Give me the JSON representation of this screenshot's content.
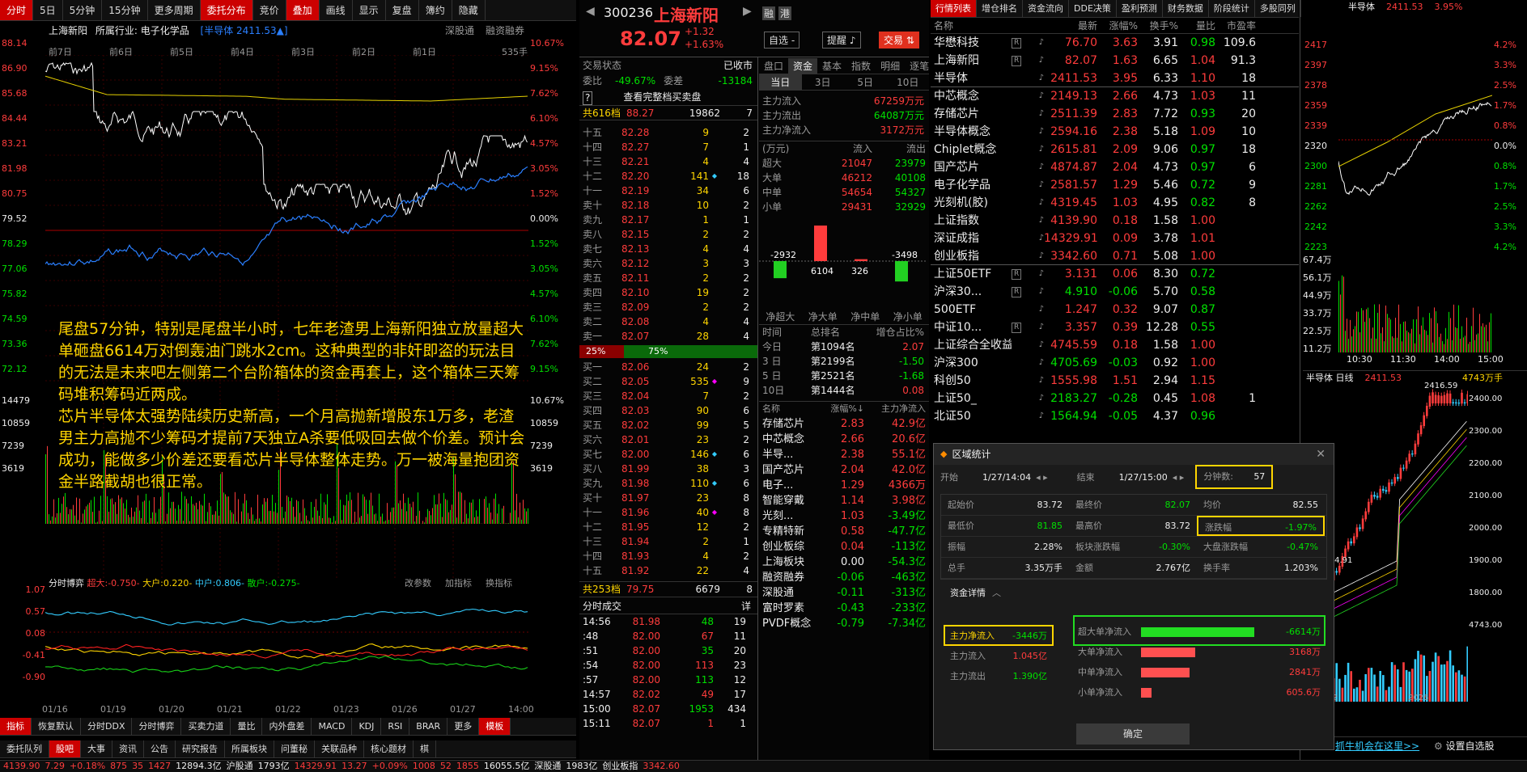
{
  "left": {
    "tabs": [
      "分时",
      "5日",
      "5分钟",
      "15分钟",
      "更多周期",
      "委托分布",
      "竞价",
      "叠加",
      "画线",
      "显示",
      "复盘",
      "簿约",
      "隐藏"
    ],
    "stock_name": "上海新阳",
    "industry": "所属行业: 电子化学品",
    "overlay": "[半导体 2411.53▲]",
    "top_right": [
      "深股通",
      "融资融券"
    ],
    "days": [
      "前7日",
      "前6日",
      "前5日",
      "前4日",
      "前3日",
      "前2日",
      "前1日"
    ],
    "vol_label": "535手",
    "price_axis": [
      "88.14",
      "86.90",
      "85.68",
      "84.44",
      "83.21",
      "81.98",
      "80.75",
      "79.52",
      "78.29",
      "77.06",
      "75.82",
      "74.59",
      "73.36",
      "72.12",
      "14479",
      "10859",
      "7239",
      "3619"
    ],
    "pct_axis": [
      "10.67%",
      "9.15%",
      "7.62%",
      "6.10%",
      "4.57%",
      "3.05%",
      "1.52%",
      "0.00%",
      "1.52%",
      "3.05%",
      "4.57%",
      "6.10%",
      "7.62%",
      "9.15%",
      "10.67%",
      "10859",
      "7239",
      "3619"
    ],
    "annotation": "尾盘57分钟，特别是尾盘半小时，七年老渣男上海新阳独立放量超大单砸盘6614万对倒轰油门跳水2cm。这种典型的非奸即盗的玩法目的无法是未来吧左侧第二个台阶箱体的资金再套上，这个箱体三天筹码堆积筹码近两成。\n芯片半导体太强势陆续历史新高，一个月高抛新增股东1万多，老渣男主力高抛不少筹码才提前7天独立A杀要低吸回去做个价差。预计会成功，能做多少价差还要看芯片半导体整体走势。万一被海量抱团资金半路截胡也很正常。",
    "indicator_title": "分时博弈",
    "indicator_vals": [
      "超大:-0.750-",
      "大户:0.220-",
      "中户:0.806-",
      "散户:-0.275-"
    ],
    "indicator_btns": [
      "改参数",
      "加指标",
      "换指标"
    ],
    "ind_axis": [
      "1.07",
      "0.57",
      "0.08",
      "-0.41",
      "-0.90"
    ],
    "dates": [
      "01/16",
      "01/19",
      "01/20",
      "01/21",
      "01/22",
      "01/23",
      "01/26",
      "01/27",
      "14:00"
    ],
    "bottom_tabs": [
      "指标",
      "恢复默认",
      "分时DDX",
      "分时博弈",
      "买卖力道",
      "量比",
      "内外盘差",
      "MACD",
      "KDJ",
      "RSI",
      "BRAR",
      "更多",
      "模板"
    ],
    "footer_tabs": [
      "委托队列",
      "股吧",
      "大事",
      "资讯",
      "公告",
      "研究报告",
      "所属板块",
      "问董秘",
      "关联品种",
      "核心题材",
      "棋"
    ]
  },
  "mid": {
    "code": "300236",
    "name": "上海新阳",
    "price": "82.07",
    "chg": "+1.32",
    "pct": "+1.63%",
    "badges": [
      "融",
      "港"
    ],
    "btn_self": "自选 -",
    "btn_alert": "提醒",
    "btn_trade": "交易",
    "status_label": "交易状态",
    "status": "已收市",
    "wb_label": "委比",
    "wb": "-49.67%",
    "wc_label": "委差",
    "wc": "-13184",
    "view_all": "查看完整档买卖盘",
    "total_sell_label": "共616档",
    "total_sell_px": "88.27",
    "total_sell_vol": "19862",
    "total_sell_n": "7",
    "asks": [
      [
        "十五",
        "82.28",
        "9",
        "2"
      ],
      [
        "十四",
        "82.27",
        "7",
        "1"
      ],
      [
        "十三",
        "82.21",
        "4",
        "4"
      ],
      [
        "十二",
        "82.20",
        "141",
        "18"
      ],
      [
        "十一",
        "82.19",
        "34",
        "6"
      ],
      [
        "卖十",
        "82.18",
        "10",
        "2"
      ],
      [
        "卖九",
        "82.17",
        "1",
        "1"
      ],
      [
        "卖八",
        "82.15",
        "2",
        "2"
      ],
      [
        "卖七",
        "82.13",
        "4",
        "4"
      ],
      [
        "卖六",
        "82.12",
        "3",
        "3"
      ],
      [
        "卖五",
        "82.11",
        "2",
        "2"
      ],
      [
        "卖四",
        "82.10",
        "19",
        "2"
      ],
      [
        "卖三",
        "82.09",
        "2",
        "2"
      ],
      [
        "卖二",
        "82.08",
        "4",
        "4"
      ],
      [
        "卖一",
        "82.07",
        "28",
        "4"
      ]
    ],
    "ratio_l": "25%",
    "ratio_r": "75%",
    "bids": [
      [
        "买一",
        "82.06",
        "24",
        "2"
      ],
      [
        "买二",
        "82.05",
        "535",
        "9"
      ],
      [
        "买三",
        "82.04",
        "7",
        "2"
      ],
      [
        "买四",
        "82.03",
        "90",
        "6"
      ],
      [
        "买五",
        "82.02",
        "99",
        "5"
      ],
      [
        "买六",
        "82.01",
        "23",
        "2"
      ],
      [
        "买七",
        "82.00",
        "146",
        "6"
      ],
      [
        "买八",
        "81.99",
        "38",
        "3"
      ],
      [
        "买九",
        "81.98",
        "110",
        "6"
      ],
      [
        "买十",
        "81.97",
        "23",
        "8"
      ],
      [
        "十一",
        "81.96",
        "40",
        "8"
      ],
      [
        "十二",
        "81.95",
        "12",
        "2"
      ],
      [
        "十三",
        "81.94",
        "2",
        "1"
      ],
      [
        "十四",
        "81.93",
        "4",
        "2"
      ],
      [
        "十五",
        "81.92",
        "22",
        "4"
      ]
    ],
    "total_buy_label": "共253档",
    "total_buy_px": "79.75",
    "total_buy_vol": "6679",
    "total_buy_n": "8",
    "trades_title": "分时成交",
    "trades_btn": "详",
    "trades": [
      [
        "14:56",
        "81.98",
        "48",
        "19"
      ],
      [
        ":48",
        "82.00",
        "67",
        "11"
      ],
      [
        ":51",
        "82.00",
        "35",
        "20"
      ],
      [
        ":54",
        "82.00",
        "113",
        "23"
      ],
      [
        ":57",
        "82.00",
        "113",
        "12"
      ],
      [
        "14:57",
        "82.02",
        "49",
        "17"
      ],
      [
        "15:00",
        "82.07",
        "1953",
        "434"
      ],
      [
        "15:11",
        "82.07",
        "1",
        "1"
      ]
    ],
    "fund_tabs": [
      "盘口",
      "资金",
      "基本",
      "指数",
      "明细",
      "逐笔"
    ],
    "period_tabs": [
      "当日",
      "3日",
      "5日",
      "10日"
    ],
    "flow": [
      [
        "主力流入",
        "67259万元"
      ],
      [
        "主力流出",
        "64087万元"
      ],
      [
        "主力净流入",
        "3172万元"
      ]
    ],
    "flow_hdr": [
      "(万元)",
      "流入",
      "流出"
    ],
    "flow_tbl": [
      [
        "超大",
        "21047",
        "23979"
      ],
      [
        "大单",
        "46212",
        "40108"
      ],
      [
        "中单",
        "54654",
        "54327"
      ],
      [
        "小单",
        "29431",
        "32929"
      ]
    ],
    "bar_vals": [
      "-2932",
      "6104",
      "326",
      "-3498"
    ],
    "bar_data": [
      -2932,
      6104,
      326,
      -3498
    ],
    "bar_labels": [
      "净超大",
      "净大单",
      "净中单",
      "净小单"
    ],
    "rank_hdr": [
      "时间",
      "总排名",
      "增仓占比%"
    ],
    "rank": [
      [
        "今日",
        "第1094名",
        "2.07"
      ],
      [
        "3 日",
        "第2199名",
        "-1.50"
      ],
      [
        "5 日",
        "第2521名",
        "-1.68"
      ],
      [
        "10日",
        "第1444名",
        "0.08"
      ]
    ],
    "sec_hdr": [
      "名称",
      "涨幅%↓",
      "主力净流入"
    ],
    "sectors": [
      [
        "存储芯片",
        "2.83",
        "42.9亿"
      ],
      [
        "中芯概念",
        "2.66",
        "20.6亿"
      ],
      [
        "半导...",
        "2.38",
        "55.1亿"
      ],
      [
        "国产芯片",
        "2.04",
        "42.0亿"
      ],
      [
        "电子...",
        "1.29",
        "4366万"
      ],
      [
        "智能穿戴",
        "1.14",
        "3.98亿"
      ],
      [
        "光刻...",
        "1.03",
        "-3.49亿"
      ],
      [
        "专精特新",
        "0.58",
        "-47.7亿"
      ],
      [
        "创业板综",
        "0.04",
        "-113亿"
      ],
      [
        "上海板块",
        "0.00",
        "-54.3亿"
      ],
      [
        "融资融券",
        "-0.06",
        "-463亿"
      ],
      [
        "深股通",
        "-0.11",
        "-313亿"
      ],
      [
        "富时罗素",
        "-0.43",
        "-233亿"
      ],
      [
        "PVDF概念",
        "-0.79",
        "-7.34亿"
      ]
    ]
  },
  "right": {
    "tabs": [
      "行情列表",
      "增仓排名",
      "资金流向",
      "DDE决策",
      "盈利预测",
      "财务数据",
      "阶段统计",
      "多股同列"
    ],
    "hdr": [
      "名称",
      "最新",
      "涨幅%",
      "换手%",
      "量比",
      "市盈率"
    ],
    "rows": [
      [
        "华懋科技",
        "R",
        "76.70",
        "3.63",
        "3.91",
        "0.98",
        "109.6"
      ],
      [
        "上海新阳",
        "R",
        "82.07",
        "1.63",
        "6.65",
        "1.04",
        "91.3"
      ],
      [
        "半导体",
        "",
        "2411.53",
        "3.95",
        "6.33",
        "1.10",
        "18"
      ],
      [
        "中芯概念",
        "",
        "2149.13",
        "2.66",
        "4.73",
        "1.03",
        "11"
      ],
      [
        "存储芯片",
        "",
        "2511.39",
        "2.83",
        "7.72",
        "0.93",
        "20"
      ],
      [
        "半导体概念",
        "",
        "2594.16",
        "2.38",
        "5.18",
        "1.09",
        "10"
      ],
      [
        "Chiplet概念",
        "",
        "2615.81",
        "2.09",
        "9.06",
        "0.97",
        "18"
      ],
      [
        "国产芯片",
        "",
        "4874.87",
        "2.04",
        "4.73",
        "0.97",
        "6"
      ],
      [
        "电子化学品",
        "",
        "2581.57",
        "1.29",
        "5.46",
        "0.72",
        "9"
      ],
      [
        "光刻机(胶)",
        "",
        "4319.45",
        "1.03",
        "4.95",
        "0.82",
        "8"
      ],
      [
        "上证指数",
        "",
        "4139.90",
        "0.18",
        "1.58",
        "1.00",
        ""
      ],
      [
        "深证成指",
        "",
        "14329.91",
        "0.09",
        "3.78",
        "1.01",
        ""
      ],
      [
        "创业板指",
        "",
        "3342.60",
        "0.71",
        "5.08",
        "1.00",
        ""
      ],
      [
        "上证50ETF",
        "R",
        "3.131",
        "0.06",
        "8.30",
        "0.72",
        ""
      ],
      [
        "沪深30...",
        "R",
        "4.910",
        "-0.06",
        "5.70",
        "0.58",
        ""
      ],
      [
        "500ETF",
        "",
        "1.247",
        "0.32",
        "9.07",
        "0.87",
        ""
      ],
      [
        "中证10...",
        "R",
        "3.357",
        "0.39",
        "12.28",
        "0.55",
        ""
      ],
      [
        "上证综合全收益",
        "",
        "4745.59",
        "0.18",
        "1.58",
        "1.00",
        ""
      ],
      [
        "沪深300",
        "",
        "4705.69",
        "-0.03",
        "0.92",
        "1.00",
        ""
      ],
      [
        "科创50",
        "",
        "1555.98",
        "1.51",
        "2.94",
        "1.15",
        ""
      ],
      [
        "上证50_",
        "",
        "2183.27",
        "-0.28",
        "0.45",
        "1.08",
        "1"
      ],
      [
        "北证50",
        "",
        "1564.94",
        "-0.05",
        "4.37",
        "0.96",
        ""
      ]
    ],
    "mini_title": "半导体",
    "mini_px": "2411.53",
    "mini_pct": "3.95%",
    "mini_axis_l": [
      "2417",
      "2397",
      "2378",
      "2359",
      "2339",
      "2320",
      "2300",
      "2281",
      "2262",
      "2242",
      "2223"
    ],
    "mini_axis_r": [
      "4.2%",
      "3.3%",
      "2.5%",
      "1.7%",
      "0.8%",
      "0.0%",
      "0.8%",
      "1.7%",
      "2.5%",
      "3.3%",
      "4.2%"
    ],
    "mini_vol": [
      "67.4万",
      "56.1万",
      "44.9万",
      "33.7万",
      "22.5万",
      "11.2万"
    ],
    "mini_times": [
      "10:30",
      "11:30",
      "14:00",
      "15:00"
    ],
    "k_title": "半导体 日线",
    "k_px": "2411.53",
    "k_vol": "4743万手",
    "k_axis": [
      "2400.00",
      "2300.00",
      "2200.00",
      "2100.00",
      "2000.00",
      "1900.00",
      "1800.00",
      "4743.00"
    ],
    "k_hi": "2416.59",
    "k_lo": "1754.91",
    "k_dates": [
      "12",
      "2026"
    ],
    "ad": "抓牛机会在这里>>",
    "setting": "设置自选股"
  },
  "dialog": {
    "title": "区域统计",
    "start_label": "开始",
    "start": "1/27/14:04",
    "end_label": "结束",
    "end": "1/27/15:00",
    "min_label": "分钟数:",
    "min": "57",
    "stats": [
      [
        "起始价",
        "83.72",
        "最终价",
        "82.07",
        "均价",
        "82.55"
      ],
      [
        "最低价",
        "81.85",
        "最高价",
        "83.72",
        "涨跌幅",
        "-1.97%"
      ],
      [
        "振幅",
        "2.28%",
        "板块涨跌幅",
        "-0.30%",
        "大盘涨跌幅",
        "-0.47%"
      ],
      [
        "总手",
        "3.35万手",
        "金额",
        "2.767亿",
        "换手率",
        "1.203%"
      ]
    ],
    "detail": "资金详情",
    "main_net_label": "主力净流入",
    "main_net": "-3446万",
    "main_in_label": "主力流入",
    "main_in": "1.045亿",
    "main_out_label": "主力流出",
    "main_out": "1.390亿",
    "flows": [
      [
        "超大单净流入",
        "-6614万"
      ],
      [
        "大单净流入",
        "3168万"
      ],
      [
        "中单净流入",
        "2841万"
      ],
      [
        "小单净流入",
        "605.6万"
      ]
    ],
    "flow_data": [
      -6614,
      3168,
      2841,
      605.6
    ],
    "ok": "确定"
  },
  "status": [
    "4139.90",
    "7.29",
    "+0.18%",
    "875",
    "35",
    "1427",
    "12894.3亿",
    "沪股通",
    "1793亿",
    "14329.91",
    "13.27",
    "+0.09%",
    "1008",
    "52",
    "1855",
    "16055.5亿",
    "深股通",
    "1983亿",
    "创业板指",
    "3342.60"
  ],
  "colors": {
    "up": "#ff3c3c",
    "down": "#00e000",
    "accent": "#ffd500",
    "blue": "#2a7fff",
    "window": "#1b1b1b"
  }
}
